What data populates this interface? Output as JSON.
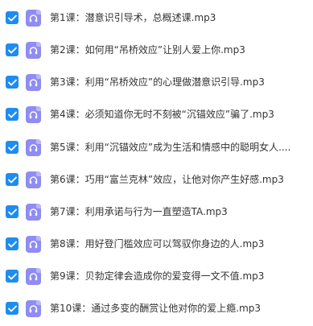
{
  "colors": {
    "checkbox": "#1e8cf0",
    "file_icon": "#8f8cf2",
    "text": "#333333"
  },
  "files": [
    {
      "name": "第1课：潜意识引导术，总概述课.mp3",
      "checked": true,
      "icon": "audio-file-icon"
    },
    {
      "name": "第2课：如何用“吊桥效应”让别人爱上你.mp3",
      "checked": true,
      "icon": "audio-file-icon"
    },
    {
      "name": "第3课：利用“吊桥效应”的心理做潜意识引导.mp3",
      "checked": true,
      "icon": "audio-file-icon"
    },
    {
      "name": "第4课：必须知道你无时不刻被“沉锚效应”骗了.mp3",
      "checked": true,
      "icon": "audio-file-icon"
    },
    {
      "name": "第5课：利用“沉锚效应”成为生活和情感中的聪明女人....",
      "checked": true,
      "icon": "audio-file-icon"
    },
    {
      "name": "第6课：巧用“富兰克林”效应，让他对你产生好感.mp3",
      "checked": true,
      "icon": "audio-file-icon"
    },
    {
      "name": "第7课：利用承诺与行为一直塑造TA.mp3",
      "checked": true,
      "icon": "audio-file-icon"
    },
    {
      "name": "第8课：用好登门槛效应可以驾驭你身边的人.mp3",
      "checked": true,
      "icon": "audio-file-icon"
    },
    {
      "name": "第9课：贝勃定律会造成你的爱变得一文不值.mp3",
      "checked": true,
      "icon": "audio-file-icon"
    },
    {
      "name": "第10课：通过多变的酬赏让他对你的爱上瘾.mp3",
      "checked": true,
      "icon": "audio-file-icon"
    }
  ]
}
